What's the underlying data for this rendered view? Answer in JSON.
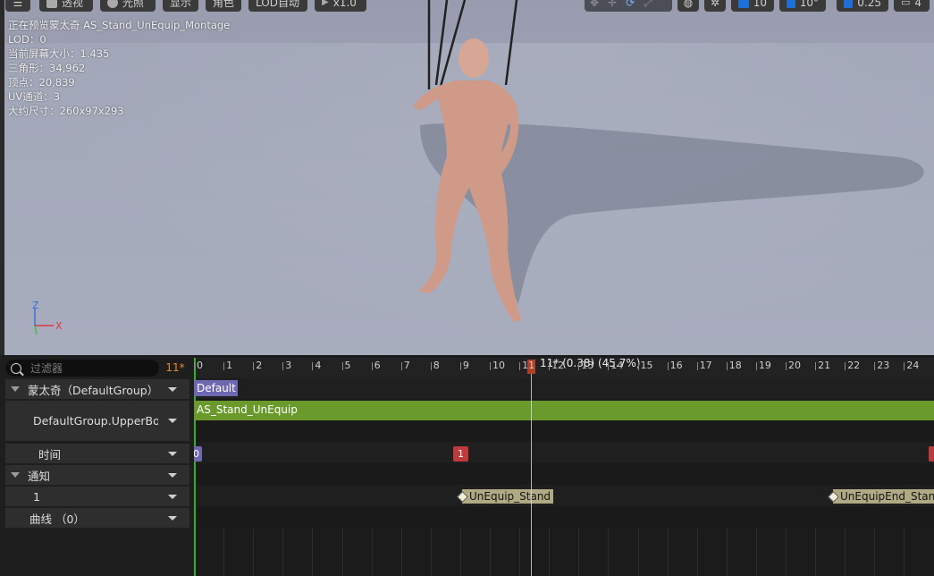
{
  "toolbar": {
    "menu_label": "",
    "perspective_label": "透视",
    "lit_label": "光照",
    "show_label": "显示",
    "character_label": "角色",
    "lod_label": "LOD自动",
    "speed_label": "x1.0",
    "grid_value": "10",
    "angle_value": "10°",
    "scale_value": "0.25",
    "camera_value": "4"
  },
  "viewport_info": {
    "preview_title": "正在预览蒙太奇 AS_Stand_UnEquip_Montage",
    "lod": "LOD：0",
    "screen_size": "当前屏幕大小：1.435",
    "triangles": "三角形：34,962",
    "vertices": "顶点：20,839",
    "uv_channels": "UV通道：3",
    "approx_size": "大约尺寸：260x97x293"
  },
  "axis": {
    "z": "Z",
    "x": "X"
  },
  "timeline": {
    "filter_placeholder": "过滤器",
    "current_frame": "11*",
    "playhead_label": "11* (0.38) (45.7%)",
    "ticks": [
      "0",
      "1",
      "2",
      "3",
      "4",
      "5",
      "6",
      "7",
      "8",
      "9",
      "10",
      "11",
      "12",
      "13",
      "14",
      "15",
      "16",
      "17",
      "18",
      "19",
      "20",
      "21",
      "22",
      "23",
      "24"
    ],
    "tracks": {
      "montage_group": "蒙太奇（DefaultGroup）",
      "slot_name": "DefaultGroup.UpperBody",
      "time": "时间",
      "notifies": "通知",
      "notify_track": "1",
      "curves": "曲线 （0）"
    },
    "section_label": "Default",
    "segment_label": "AS_Stand_UnEquip",
    "time_markers": [
      "0",
      "1"
    ],
    "notifies": [
      "UnEquip_Stand",
      "UnEquipEnd_Stand"
    ]
  },
  "colors": {
    "montage_bar": "#6a9a2c",
    "section": "#6e68b0",
    "marker": "#c0393c",
    "notify": "#b0aa84",
    "playhead": "#b0402a"
  }
}
